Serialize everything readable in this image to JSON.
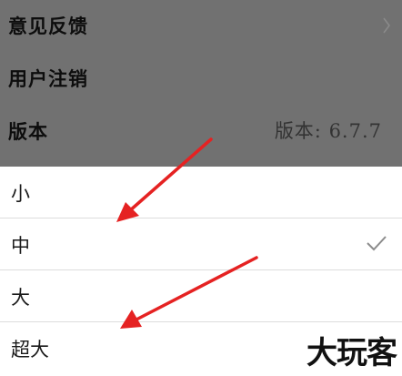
{
  "settings": {
    "rows": [
      {
        "label": "意见反馈"
      },
      {
        "label": "用户注销"
      },
      {
        "label": "版本",
        "value": "版本: 6.7.7"
      }
    ]
  },
  "font_size_sheet": {
    "options": [
      "小",
      "中",
      "大",
      "超大"
    ],
    "selected": "中"
  },
  "icons": {
    "chevron": "chevron-right-icon",
    "check": "check-icon"
  },
  "colors": {
    "overlay_bg": "#717171",
    "annotation_arrow": "#e52222"
  },
  "watermark": "大玩客"
}
